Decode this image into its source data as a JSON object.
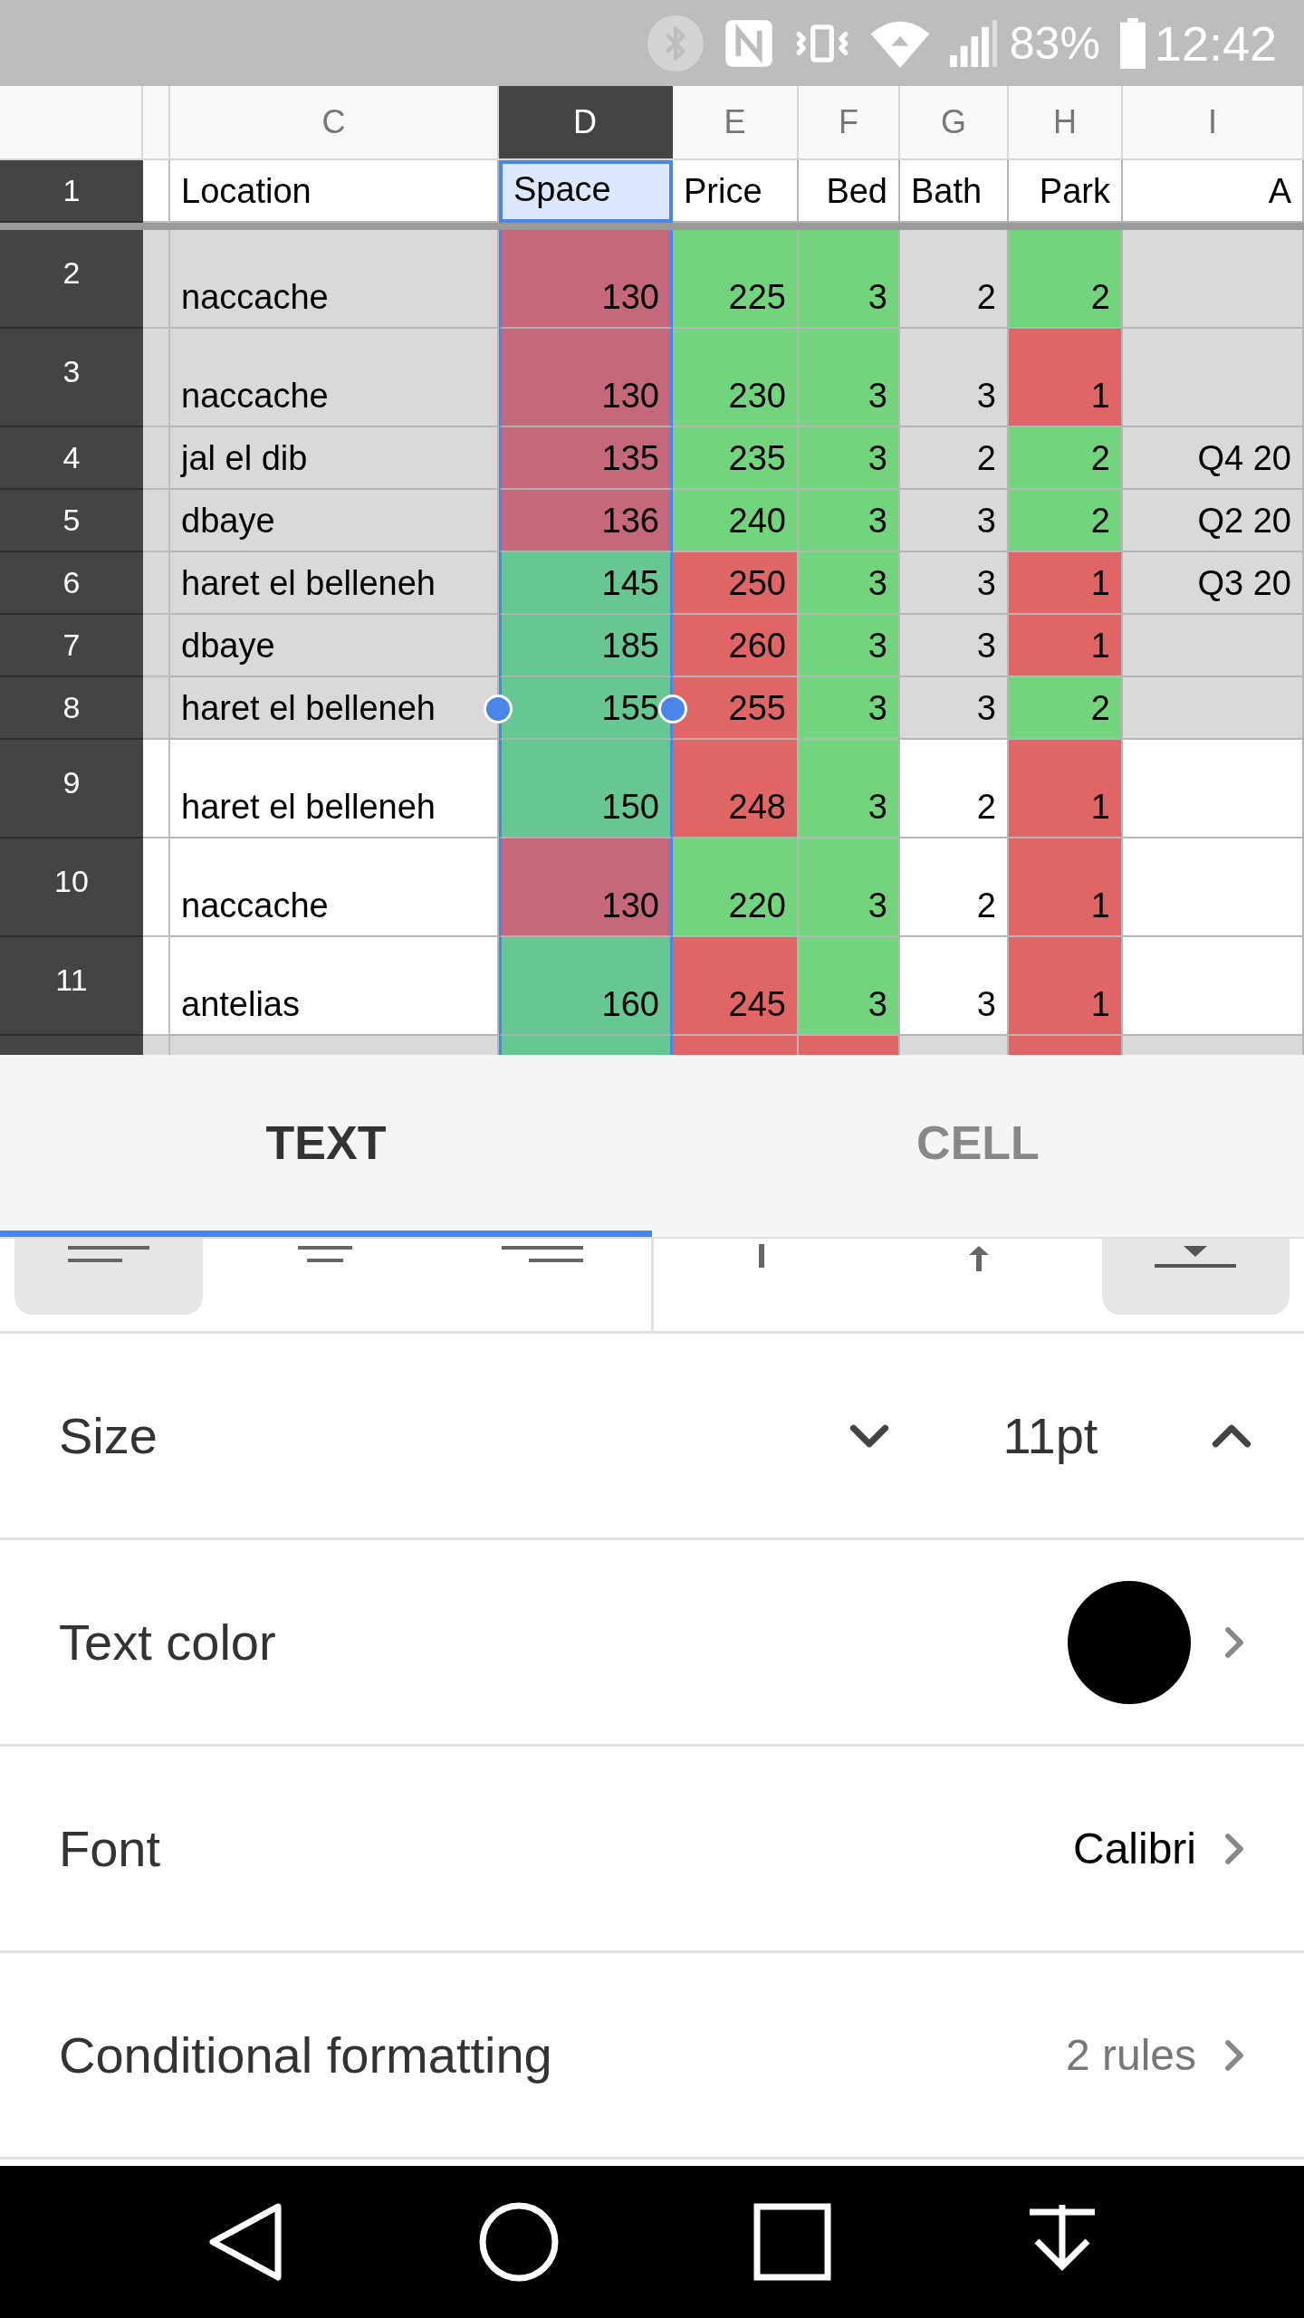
{
  "status_bar": {
    "battery": "83%",
    "time": "12:42"
  },
  "sheet": {
    "columns": [
      {
        "label": "C",
        "selected": false
      },
      {
        "label": "D",
        "selected": true
      },
      {
        "label": "E",
        "selected": false
      },
      {
        "label": "F",
        "selected": false
      },
      {
        "label": "G",
        "selected": false
      },
      {
        "label": "H",
        "selected": false
      },
      {
        "label": "I",
        "selected": false
      }
    ],
    "rows": [
      {
        "number": "1",
        "shaded": false,
        "tall": false,
        "handles": false,
        "cells": [
          {
            "kind": "text",
            "text": "Location"
          },
          {
            "kind": "text",
            "text": "Space"
          },
          {
            "kind": "text",
            "text": "Price"
          },
          {
            "kind": "number",
            "text": "Bed"
          },
          {
            "kind": "text",
            "text": "Bath"
          },
          {
            "kind": "number",
            "text": "Park"
          },
          {
            "kind": "number",
            "text": "A"
          }
        ]
      },
      {
        "number": "2",
        "shaded": true,
        "tall": true,
        "handles": false,
        "cells": [
          {
            "kind": "text",
            "text": "naccache"
          },
          {
            "kind": "number",
            "text": "130",
            "color": "#c4687a"
          },
          {
            "kind": "number",
            "text": "225",
            "color": "#72d47c"
          },
          {
            "kind": "number",
            "text": "3",
            "color": "#72d47c"
          },
          {
            "kind": "number",
            "text": "2"
          },
          {
            "kind": "number",
            "text": "2",
            "color": "#72d47c"
          },
          {
            "kind": "number"
          }
        ]
      },
      {
        "number": "3",
        "shaded": true,
        "tall": true,
        "handles": false,
        "cells": [
          {
            "kind": "text",
            "text": "naccache"
          },
          {
            "kind": "number",
            "text": "130",
            "color": "#c4687a"
          },
          {
            "kind": "number",
            "text": "230",
            "color": "#72d47c"
          },
          {
            "kind": "number",
            "text": "3",
            "color": "#72d47c"
          },
          {
            "kind": "number",
            "text": "3"
          },
          {
            "kind": "number",
            "text": "1",
            "color": "#e06666"
          },
          {
            "kind": "number"
          }
        ]
      },
      {
        "number": "4",
        "shaded": true,
        "tall": false,
        "handles": false,
        "cells": [
          {
            "kind": "text",
            "text": "jal el dib"
          },
          {
            "kind": "number",
            "text": "135",
            "color": "#c4687a"
          },
          {
            "kind": "number",
            "text": "235",
            "color": "#72d47c"
          },
          {
            "kind": "number",
            "text": "3",
            "color": "#72d47c"
          },
          {
            "kind": "number",
            "text": "2"
          },
          {
            "kind": "number",
            "text": "2",
            "color": "#72d47c"
          },
          {
            "kind": "number",
            "text": "Q4 20"
          }
        ]
      },
      {
        "number": "5",
        "shaded": true,
        "tall": false,
        "handles": false,
        "cells": [
          {
            "kind": "text",
            "text": "dbaye"
          },
          {
            "kind": "number",
            "text": "136",
            "color": "#c4687a"
          },
          {
            "kind": "number",
            "text": "240",
            "color": "#72d47c"
          },
          {
            "kind": "number",
            "text": "3",
            "color": "#72d47c"
          },
          {
            "kind": "number",
            "text": "3"
          },
          {
            "kind": "number",
            "text": "2",
            "color": "#72d47c"
          },
          {
            "kind": "number",
            "text": "Q2 20"
          }
        ]
      },
      {
        "number": "6",
        "shaded": true,
        "tall": false,
        "handles": false,
        "cells": [
          {
            "kind": "text",
            "text": "haret el belleneh"
          },
          {
            "kind": "number",
            "text": "145",
            "color": "#66c793"
          },
          {
            "kind": "number",
            "text": "250",
            "color": "#e06666"
          },
          {
            "kind": "number",
            "text": "3",
            "color": "#72d47c"
          },
          {
            "kind": "number",
            "text": "3"
          },
          {
            "kind": "number",
            "text": "1",
            "color": "#e06666"
          },
          {
            "kind": "number",
            "text": "Q3 20"
          }
        ]
      },
      {
        "number": "7",
        "shaded": true,
        "tall": false,
        "handles": false,
        "cells": [
          {
            "kind": "text",
            "text": "dbaye"
          },
          {
            "kind": "number",
            "text": "185",
            "color": "#66c793"
          },
          {
            "kind": "number",
            "text": "260",
            "color": "#e06666"
          },
          {
            "kind": "number",
            "text": "3",
            "color": "#72d47c"
          },
          {
            "kind": "number",
            "text": "3"
          },
          {
            "kind": "number",
            "text": "1",
            "color": "#e06666"
          },
          {
            "kind": "number"
          }
        ]
      },
      {
        "number": "8",
        "shaded": true,
        "tall": false,
        "handles": true,
        "cells": [
          {
            "kind": "text",
            "text": "haret el belleneh"
          },
          {
            "kind": "number",
            "text": "155",
            "color": "#66c793"
          },
          {
            "kind": "number",
            "text": "255",
            "color": "#e06666"
          },
          {
            "kind": "number",
            "text": "3",
            "color": "#72d47c"
          },
          {
            "kind": "number",
            "text": "3"
          },
          {
            "kind": "number",
            "text": "2",
            "color": "#72d47c"
          },
          {
            "kind": "number"
          }
        ]
      },
      {
        "number": "9",
        "shaded": false,
        "tall": true,
        "handles": false,
        "cells": [
          {
            "kind": "text",
            "text": "haret el belleneh"
          },
          {
            "kind": "number",
            "text": "150",
            "color": "#66c793"
          },
          {
            "kind": "number",
            "text": "248",
            "color": "#e06666"
          },
          {
            "kind": "number",
            "text": "3",
            "color": "#72d47c"
          },
          {
            "kind": "number",
            "text": "2"
          },
          {
            "kind": "number",
            "text": "1",
            "color": "#e06666"
          },
          {
            "kind": "number"
          }
        ]
      },
      {
        "number": "10",
        "shaded": false,
        "tall": true,
        "handles": false,
        "cells": [
          {
            "kind": "text",
            "text": "naccache"
          },
          {
            "kind": "number",
            "text": "130",
            "color": "#c4687a"
          },
          {
            "kind": "number",
            "text": "220",
            "color": "#72d47c"
          },
          {
            "kind": "number",
            "text": "3",
            "color": "#72d47c"
          },
          {
            "kind": "number",
            "text": "2"
          },
          {
            "kind": "number",
            "text": "1",
            "color": "#e06666"
          },
          {
            "kind": "number"
          }
        ]
      },
      {
        "number": "11",
        "shaded": false,
        "tall": true,
        "handles": false,
        "cells": [
          {
            "kind": "text",
            "text": "antelias"
          },
          {
            "kind": "number",
            "text": "160",
            "color": "#66c793"
          },
          {
            "kind": "number",
            "text": "245",
            "color": "#e06666"
          },
          {
            "kind": "number",
            "text": "3",
            "color": "#72d47c"
          },
          {
            "kind": "number",
            "text": "3"
          },
          {
            "kind": "number",
            "text": "1",
            "color": "#e06666"
          },
          {
            "kind": "number"
          }
        ]
      },
      {
        "shaded": true,
        "tall": false,
        "handles": false,
        "cells": [
          {
            "kind": "text"
          },
          {
            "kind": "number",
            "color": "#66c793"
          },
          {
            "kind": "number",
            "color": "#e06666"
          },
          {
            "kind": "number",
            "color": "#e06666"
          },
          {
            "kind": "number"
          },
          {
            "kind": "number",
            "color": "#e06666"
          },
          {
            "kind": "number"
          }
        ]
      }
    ]
  },
  "format_panel": {
    "tabs": [
      {
        "label": "TEXT",
        "selected": true
      },
      {
        "label": "CELL",
        "selected": false
      }
    ],
    "horizontal_align": [
      {
        "selected": true
      },
      {
        "selected": false
      },
      {
        "selected": false
      }
    ],
    "vertical_align": [
      {
        "selected": false
      },
      {
        "selected": false
      },
      {
        "selected": true
      }
    ],
    "settings": [
      {
        "kind": "stepper",
        "label": "Size",
        "value": "11pt"
      },
      {
        "kind": "color",
        "label": "Text color",
        "color": "#000000"
      },
      {
        "kind": "link",
        "label": "Font",
        "value": "Calibri",
        "muted": false
      },
      {
        "kind": "link",
        "label": "Conditional formatting",
        "value": "2 rules",
        "muted": true
      }
    ]
  }
}
